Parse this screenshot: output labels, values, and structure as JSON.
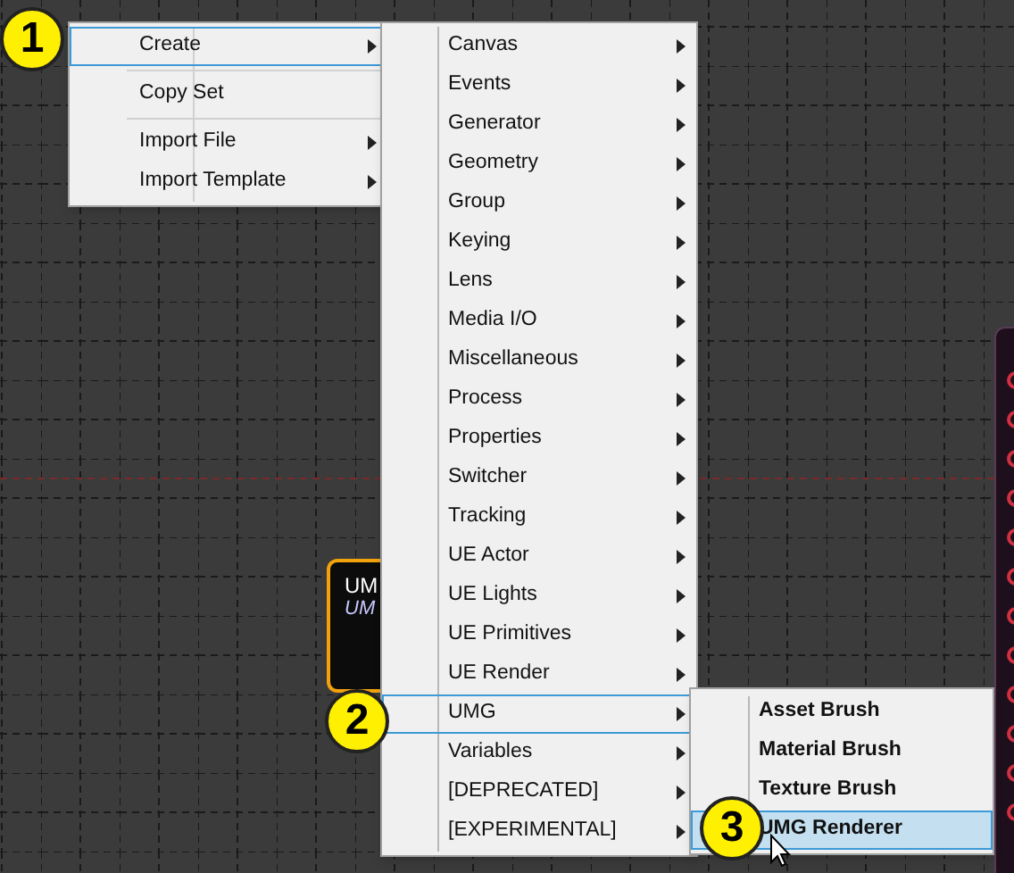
{
  "nodes": [
    {
      "title": "UM",
      "subtitle": "UM",
      "selected": true
    }
  ],
  "context_menu": {
    "items": [
      {
        "label": "Create",
        "selected": true,
        "submenu": true,
        "separator_after": true
      },
      {
        "label": "Copy Set",
        "selected": false,
        "submenu": false,
        "separator_after": true
      },
      {
        "label": "Import File",
        "selected": false,
        "submenu": true,
        "separator_after": false
      },
      {
        "label": "Import Template",
        "selected": false,
        "submenu": true,
        "separator_after": false
      }
    ]
  },
  "create_menu": {
    "items": [
      {
        "label": "Canvas",
        "selected": false
      },
      {
        "label": "Events",
        "selected": false
      },
      {
        "label": "Generator",
        "selected": false
      },
      {
        "label": "Geometry",
        "selected": false
      },
      {
        "label": "Group",
        "selected": false
      },
      {
        "label": "Keying",
        "selected": false
      },
      {
        "label": "Lens",
        "selected": false
      },
      {
        "label": "Media I/O",
        "selected": false
      },
      {
        "label": "Miscellaneous",
        "selected": false
      },
      {
        "label": "Process",
        "selected": false
      },
      {
        "label": "Properties",
        "selected": false
      },
      {
        "label": "Switcher",
        "selected": false
      },
      {
        "label": "Tracking",
        "selected": false
      },
      {
        "label": "UE Actor",
        "selected": false
      },
      {
        "label": "UE Lights",
        "selected": false
      },
      {
        "label": "UE Primitives",
        "selected": false
      },
      {
        "label": "UE Render",
        "selected": false
      },
      {
        "label": "UMG",
        "selected": true
      },
      {
        "label": "Variables",
        "selected": false
      },
      {
        "label": "[DEPRECATED]",
        "selected": false
      },
      {
        "label": "[EXPERIMENTAL]",
        "selected": false
      }
    ]
  },
  "umg_menu": {
    "items": [
      {
        "label": "Asset Brush",
        "selected": false
      },
      {
        "label": "Material Brush",
        "selected": false
      },
      {
        "label": "Texture Brush",
        "selected": false
      },
      {
        "label": "UMG Renderer",
        "selected": true
      }
    ]
  },
  "step_badges": [
    "1",
    "2",
    "3"
  ]
}
